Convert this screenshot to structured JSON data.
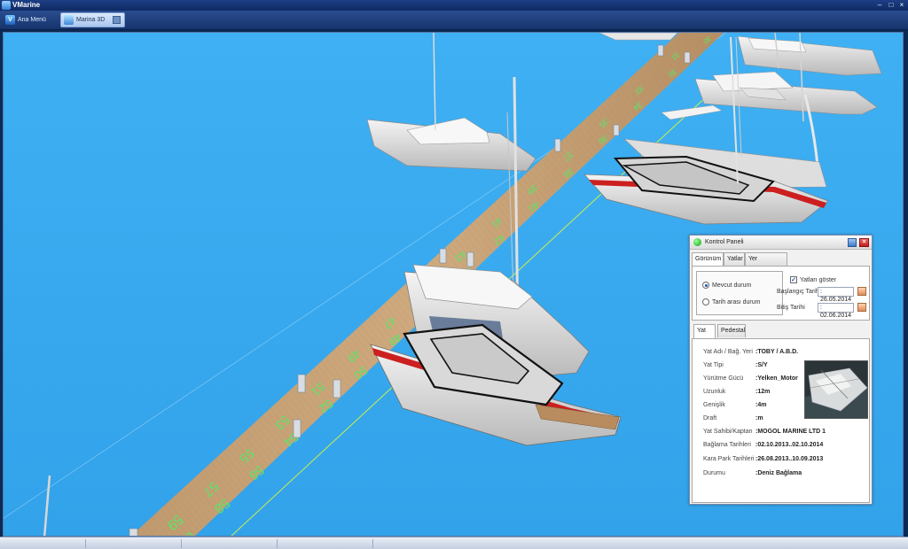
{
  "app": {
    "title": "VMarine"
  },
  "window_controls": {
    "minimize": "–",
    "restore": "□",
    "close": "×"
  },
  "tabs": [
    {
      "label": "Ana Menü",
      "icon": "vmarine-logo-icon"
    },
    {
      "label": "Marina 3D",
      "icon": "marina-3d-icon"
    }
  ],
  "scene": {
    "pier_numbers": [
      "30",
      "31",
      "32",
      "33",
      "34",
      "35",
      "36",
      "37",
      "38",
      "39",
      "40",
      "41",
      "42",
      "43",
      "44",
      "45",
      "46",
      "47",
      "48",
      "49",
      "50",
      "51",
      "52",
      "53",
      "54",
      "55",
      "56",
      "57",
      "58",
      "59",
      "60"
    ],
    "colors": {
      "water": "#3aa6ec",
      "pier": "#c8a377",
      "berth_line": "#c9f04a",
      "hull_stripe": "#cc1f1f",
      "label_green": "#59e66a"
    }
  },
  "panel": {
    "title": "Kontrol Paneli",
    "tabs": [
      "Görünüm",
      "Yatlar",
      "Yer Değiştirme"
    ],
    "selected_tab": "Görünüm",
    "radio_current": "Mevcut durum",
    "radio_range": "Tarih arası durum",
    "show_yachts_label": "Yatları göster",
    "show_yachts_checked": true,
    "start_label": "Başlangıç Tarihi",
    "start_value": ": 26.05.2014",
    "end_label": "Bitiş Tarihi",
    "end_value": ": 02.06.2014",
    "sub_tabs": [
      "Yat",
      "Pedestal"
    ],
    "details": [
      {
        "label": "Yat Adı / Bağ. Yeri",
        "value": ":TOBY / A.B.D."
      },
      {
        "label": "Yat Tipi",
        "value": ":S/Y"
      },
      {
        "label": "Yürütme Gücü",
        "value": ":Yelken_Motor"
      },
      {
        "label": "Uzunluk",
        "value": ":12m"
      },
      {
        "label": "Genişlik",
        "value": ":4m"
      },
      {
        "label": "Draft",
        "value": ":m"
      },
      {
        "label": "Yat Sahibi/Kaptan",
        "value": ":MOGOL MARINE LTD  1"
      },
      {
        "label": "Bağlama Tarihleri",
        "value": ":02.10.2013..02.10.2014"
      },
      {
        "label": "Kara Park Tarihleri",
        "value": ":26.08.2013..10.09.2013"
      },
      {
        "label": "Durumu",
        "value": ":Deniz Bağlama"
      }
    ]
  }
}
